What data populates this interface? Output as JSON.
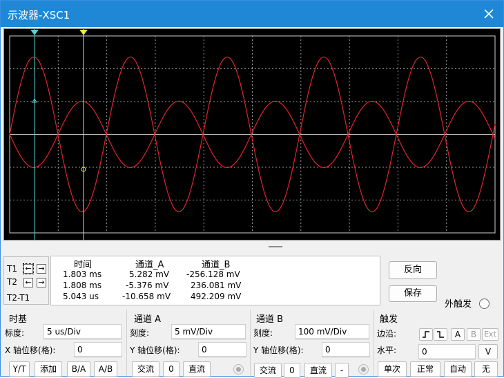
{
  "window": {
    "title": "示波器-XSC1"
  },
  "cursors": {
    "t1_marker_color": "#4fd3d8",
    "t2_marker_color": "#e8e84a"
  },
  "colors": {
    "trace": "#e0242a",
    "grid": "#9a9a9a",
    "screen_bg": "#000000",
    "titlebar": "#1e88d6"
  },
  "cursor_panel": {
    "t1": "T1",
    "t2": "T2",
    "diff": "T2-T1",
    "left_arrow": "←",
    "right_arrow": "→"
  },
  "readout": {
    "headers": [
      "时间",
      "通道_A",
      "通道_B"
    ],
    "rows": [
      [
        "1.803 ms",
        "5.282 mV",
        "-256.128 mV"
      ],
      [
        "1.808 ms",
        "-5.376 mV",
        "236.081 mV"
      ],
      [
        "5.043 us",
        "-10.658 mV",
        "492.209 mV"
      ]
    ]
  },
  "side_buttons": {
    "reverse": "反向",
    "save": "保存",
    "ext_trigger": "外触发"
  },
  "timebase": {
    "title": "时基",
    "scale_label": "标度:",
    "scale_value": "5 us/Div",
    "xpos_label": "X 轴位移(格):",
    "xpos_value": "0",
    "modes": [
      "Y/T",
      "添加",
      "B/A",
      "A/B"
    ]
  },
  "channel_a": {
    "title": "通道 A",
    "scale_label": "刻度:",
    "scale_value": "5 mV/Div",
    "ypos_label": "Y 轴位移(格):",
    "ypos_value": "0",
    "coupling": [
      "交流",
      "0",
      "直流"
    ]
  },
  "channel_b": {
    "title": "通道 B",
    "scale_label": "刻度:",
    "scale_value": "100 mV/Div",
    "ypos_label": "Y 轴位移(格):",
    "ypos_value": "0",
    "coupling": [
      "交流",
      "0",
      "直流",
      "-"
    ]
  },
  "trigger": {
    "title": "触发",
    "edge_label": "边沿:",
    "edge_rise": "⨍",
    "edge_fall": "Ʈ",
    "sources": [
      "A",
      "B",
      "Ext"
    ],
    "level_label": "水平:",
    "level_value": "0",
    "level_unit": "V",
    "modes": [
      "单次",
      "正常",
      "自动",
      "无"
    ]
  }
}
